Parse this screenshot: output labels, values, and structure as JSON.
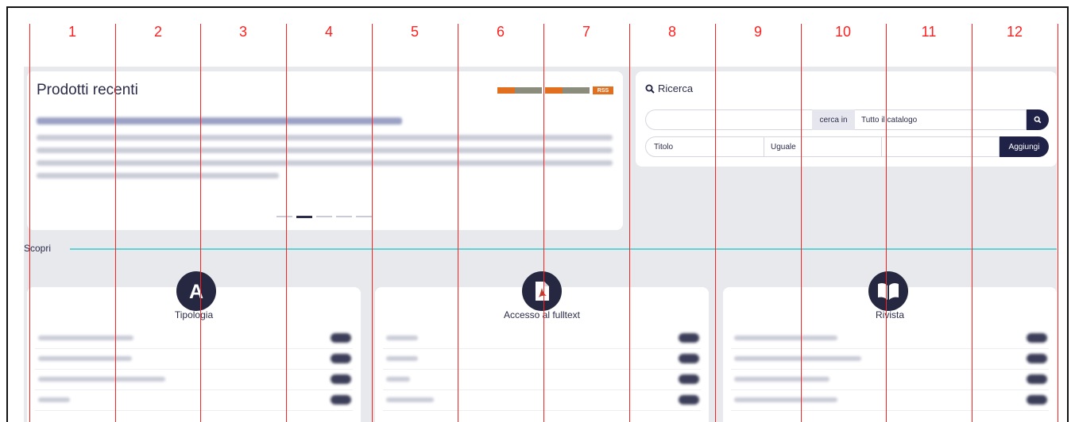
{
  "grid": {
    "columns": [
      "1",
      "2",
      "3",
      "4",
      "5",
      "6",
      "7",
      "8",
      "9",
      "10",
      "11",
      "12"
    ]
  },
  "recent": {
    "title": "Prodotti recenti",
    "rss_label": "RSS"
  },
  "search": {
    "title": "Ricerca",
    "query_value": "",
    "cerca_in_label": "cerca in",
    "scope_value": "Tutto il catalogo",
    "field_value": "Titolo",
    "operator_value": "Uguale",
    "term_value": "",
    "add_label": "Aggiungi",
    "icon": "search-icon"
  },
  "scopri": {
    "label": "Scopri"
  },
  "facets": [
    {
      "title": "Tipologia",
      "icon": "letter-a-icon",
      "rows": 4
    },
    {
      "title": "Accesso al fulltext",
      "icon": "pdf-document-icon",
      "rows": 4
    },
    {
      "title": "Rivista",
      "icon": "open-book-icon",
      "rows": 4
    }
  ],
  "colors": {
    "navy": "#1f2147",
    "gridline": "#ff2020",
    "accent_rule": "#63d1d4",
    "background": "#e8e9ed"
  }
}
